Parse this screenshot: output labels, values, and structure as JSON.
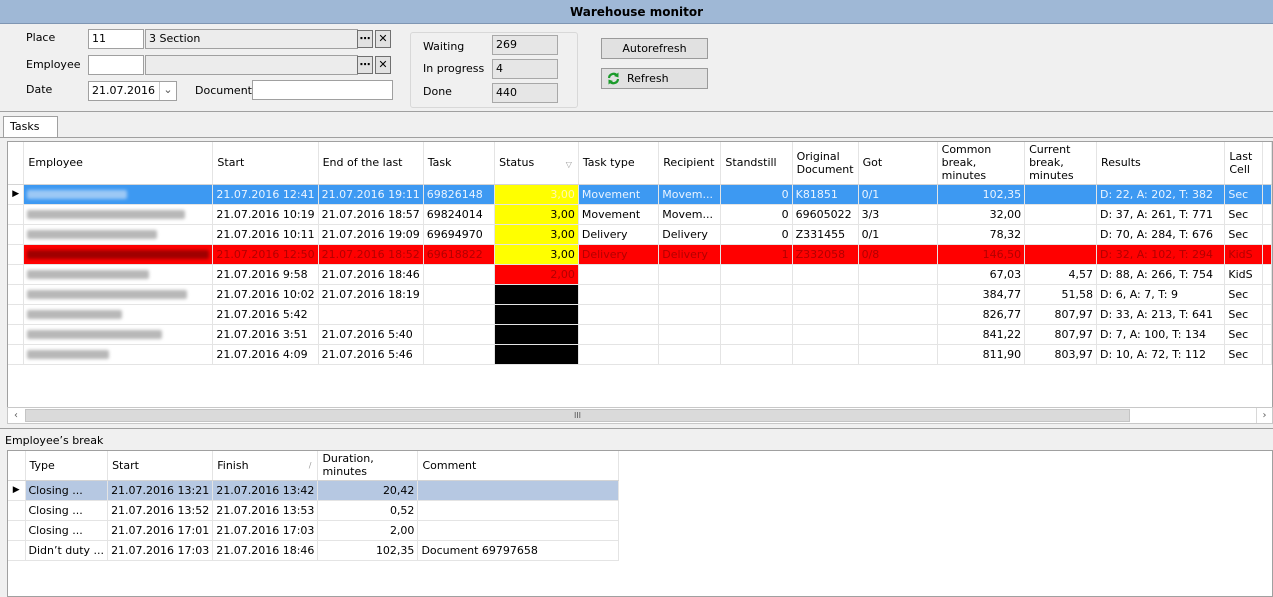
{
  "window": {
    "title": "Warehouse monitor"
  },
  "filters": {
    "place_label": "Place",
    "place_code": "11",
    "place_name": "3 Section",
    "employee_label": "Employee",
    "employee_code": "",
    "employee_name": "",
    "date_label": "Date",
    "date_value": "21.07.2016",
    "document_label": "Document",
    "document_value": "",
    "browse_glyph": "⋯",
    "clear_glyph": "✕",
    "dropdown_glyph": "⌄"
  },
  "counters": {
    "waiting_label": "Waiting",
    "waiting_value": "269",
    "in_progress_label": "In progress",
    "in_progress_value": "4",
    "done_label": "Done",
    "done_value": "440"
  },
  "buttons": {
    "autorefresh": "Autorefresh",
    "refresh": "Refresh"
  },
  "tabs": [
    {
      "label": "Tasks"
    }
  ],
  "colors": {
    "selected": "#3d99f2",
    "alert_red": "#ff0000",
    "status_yellow": "#ffff00",
    "status_black": "#000000",
    "titlebar": "#9fb8d6"
  },
  "tasks": {
    "columns": [
      "Employee",
      "Start",
      "End of the last",
      "Task",
      "Status",
      "Task type",
      "Recipient",
      "Standstill",
      "Original Document",
      "Got",
      "Common break, minutes",
      "Current break, minutes",
      "Results",
      "Last Cell"
    ],
    "rows": [
      {
        "employee": "(blurred)",
        "start": "21.07.2016 12:41",
        "end": "21.07.2016 19:11",
        "task": "69826148",
        "status": "3,00",
        "status_color": "yellow",
        "task_type": "Movement",
        "recipient": "Movem...",
        "standstill": "0",
        "orig_doc": "K81851",
        "got": "0/1",
        "common_break": "102,35",
        "current_break": "",
        "results": "D: 22, A: 202, T: 382",
        "last_cell": "Sec",
        "row_style": "sel"
      },
      {
        "employee": "(blurred)",
        "start": "21.07.2016 10:19",
        "end": "21.07.2016 18:57",
        "task": "69824014",
        "status": "3,00",
        "status_color": "yellow",
        "task_type": "Movement",
        "recipient": "Movem...",
        "standstill": "0",
        "orig_doc": "69605022",
        "got": "3/3",
        "common_break": "32,00",
        "current_break": "",
        "results": "D: 37, A: 261, T: 771",
        "last_cell": "Sec",
        "row_style": ""
      },
      {
        "employee": "(blurred)",
        "start": "21.07.2016 10:11",
        "end": "21.07.2016 19:09",
        "task": "69694970",
        "status": "3,00",
        "status_color": "yellow",
        "task_type": "Delivery",
        "recipient": "Delivery",
        "standstill": "0",
        "orig_doc": "Z331455",
        "got": "0/1",
        "common_break": "78,32",
        "current_break": "",
        "results": "D: 70, A: 284, T: 676",
        "last_cell": "Sec",
        "row_style": ""
      },
      {
        "employee": "(blurred)",
        "start": "21.07.2016 12:50",
        "end": "21.07.2016 18:52",
        "task": "69618822",
        "status": "3,00",
        "status_color": "yellow",
        "task_type": "Delivery",
        "recipient": "Delivery",
        "standstill": "1",
        "orig_doc": "Z332058",
        "got": "0/8",
        "common_break": "146,50",
        "current_break": "",
        "results": "D: 32, A: 102, T: 294",
        "last_cell": "KidS",
        "row_style": "red"
      },
      {
        "employee": "(blurred)",
        "start": "21.07.2016 9:58",
        "end": "21.07.2016 18:46",
        "task": "",
        "status": "2,00",
        "status_color": "red",
        "task_type": "",
        "recipient": "",
        "standstill": "",
        "orig_doc": "",
        "got": "",
        "common_break": "67,03",
        "current_break": "4,57",
        "results": "D: 88, A: 266, T: 754",
        "last_cell": "KidS",
        "row_style": ""
      },
      {
        "employee": "(blurred)",
        "start": "21.07.2016 10:02",
        "end": "21.07.2016 18:19",
        "task": "",
        "status": "",
        "status_color": "black",
        "task_type": "",
        "recipient": "",
        "standstill": "",
        "orig_doc": "",
        "got": "",
        "common_break": "384,77",
        "current_break": "51,58",
        "results": "D: 6, A: 7, T: 9",
        "last_cell": "Sec",
        "row_style": ""
      },
      {
        "employee": "(blurred)",
        "start": "21.07.2016 5:42",
        "end": "",
        "task": "",
        "status": "",
        "status_color": "black",
        "task_type": "",
        "recipient": "",
        "standstill": "",
        "orig_doc": "",
        "got": "",
        "common_break": "826,77",
        "current_break": "807,97",
        "results": "D: 33, A: 213, T: 641",
        "last_cell": "Sec",
        "row_style": ""
      },
      {
        "employee": "(blurred)",
        "start": "21.07.2016 3:51",
        "end": "21.07.2016 5:40",
        "task": "",
        "status": "",
        "status_color": "black",
        "task_type": "",
        "recipient": "",
        "standstill": "",
        "orig_doc": "",
        "got": "",
        "common_break": "841,22",
        "current_break": "807,97",
        "results": "D: 7, A: 100, T: 134",
        "last_cell": "Sec",
        "row_style": ""
      },
      {
        "employee": "(blurred)",
        "start": "21.07.2016 4:09",
        "end": "21.07.2016 5:46",
        "task": "",
        "status": "",
        "status_color": "black",
        "task_type": "",
        "recipient": "",
        "standstill": "",
        "orig_doc": "",
        "got": "",
        "common_break": "811,90",
        "current_break": "803,97",
        "results": "D: 10, A: 72, T: 112",
        "last_cell": "Sec",
        "row_style": ""
      }
    ]
  },
  "breaks": {
    "title": "Employee’s break",
    "columns": [
      "Type",
      "Start",
      "Finish",
      "Duration, minutes",
      "Comment"
    ],
    "rows": [
      {
        "type": "Closing ...",
        "start": "21.07.2016 13:21",
        "finish": "21.07.2016 13:42",
        "duration": "20,42",
        "comment": "",
        "selected": true
      },
      {
        "type": "Closing ...",
        "start": "21.07.2016 13:52",
        "finish": "21.07.2016 13:53",
        "duration": "0,52",
        "comment": "",
        "selected": false
      },
      {
        "type": "Closing ...",
        "start": "21.07.2016 17:01",
        "finish": "21.07.2016 17:03",
        "duration": "2,00",
        "comment": "",
        "selected": false
      },
      {
        "type": "Didn’t duty ...",
        "start": "21.07.2016 17:03",
        "finish": "21.07.2016 18:46",
        "duration": "102,35",
        "comment": "Document 69797658",
        "selected": false
      }
    ]
  },
  "scrollbar": {
    "left_glyph": "‹",
    "right_glyph": "›",
    "grip_glyph": "III"
  },
  "indicator_glyph": "▶",
  "sort_glyph": "▽"
}
